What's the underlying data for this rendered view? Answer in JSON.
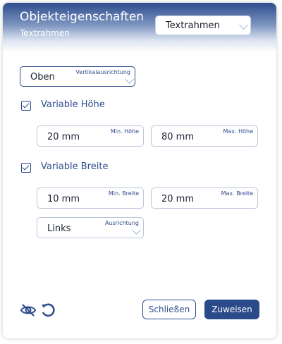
{
  "dialog": {
    "title": "Objekteigenschaften",
    "subtitle": "Textrahmen",
    "type_select": {
      "value": "Textrahmen"
    }
  },
  "vertical_alignment": {
    "value": "Oben",
    "label": "Vertikalausrichtung"
  },
  "variable_height": {
    "label": "Variable Höhe",
    "checked": true,
    "min": {
      "value": "20 mm",
      "label": "Min. Höhe"
    },
    "max": {
      "value": "80 mm",
      "label": "Max. Höhe"
    }
  },
  "variable_width": {
    "label": "Variable Breite",
    "checked": true,
    "min": {
      "value": "10 mm",
      "label": "Min. Breite"
    },
    "max": {
      "value": "20 mm",
      "label": "Max. Breite"
    },
    "alignment": {
      "value": "Links",
      "label": "Ausrichtung"
    }
  },
  "footer": {
    "close_label": "Schließen",
    "apply_label": "Zuweisen"
  },
  "colors": {
    "accent": "#2f4d8f",
    "primary_button": "#2b4a8a"
  }
}
